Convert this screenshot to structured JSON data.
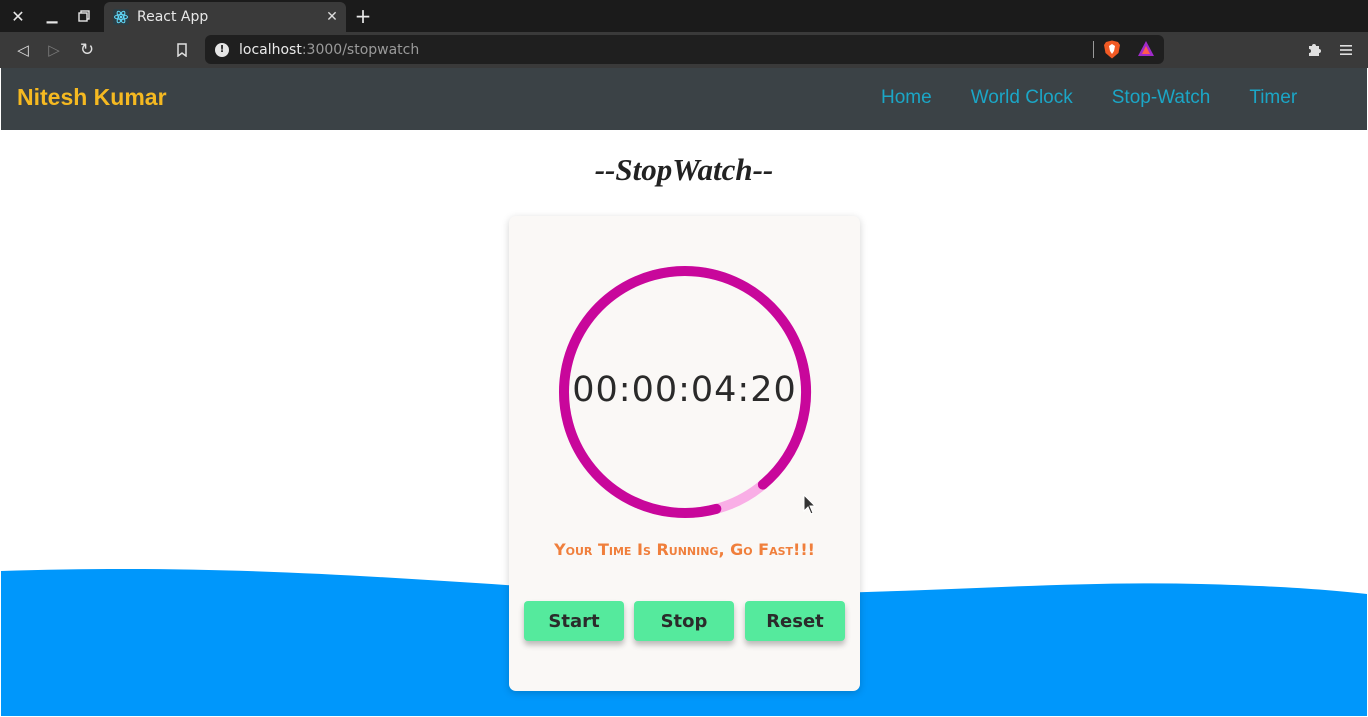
{
  "browser": {
    "tab_title": "React App",
    "url_host": "localhost",
    "url_rest": ":3000/stopwatch"
  },
  "app": {
    "brand": "Nitesh Kumar",
    "nav": [
      "Home",
      "World Clock",
      "Stop-Watch",
      "Timer"
    ]
  },
  "stopwatch": {
    "title": "--StopWatch--",
    "time": "00:00:04:20",
    "progress_fraction": 0.93,
    "message": "Your Time Is Running, Go Fast!!!",
    "buttons": {
      "start": "Start",
      "stop": "Stop",
      "reset": "Reset"
    }
  },
  "colors": {
    "navbar": "#3b4246",
    "brand": "#f5b921",
    "nav_link": "#1ba6c6",
    "ring_primary": "#c8079b",
    "ring_secondary": "#f9aee6",
    "message": "#f07f3c",
    "button": "#55ea9d",
    "wave": "#0097fb"
  },
  "icons": [
    "close-icon",
    "minimize-icon",
    "restore-icon",
    "react-icon",
    "plus-icon",
    "back-icon",
    "forward-icon",
    "reload-icon",
    "bookmark-icon",
    "info-icon",
    "brave-shield-icon",
    "brave-rewards-icon",
    "extensions-icon",
    "menu-icon",
    "cursor-icon"
  ]
}
